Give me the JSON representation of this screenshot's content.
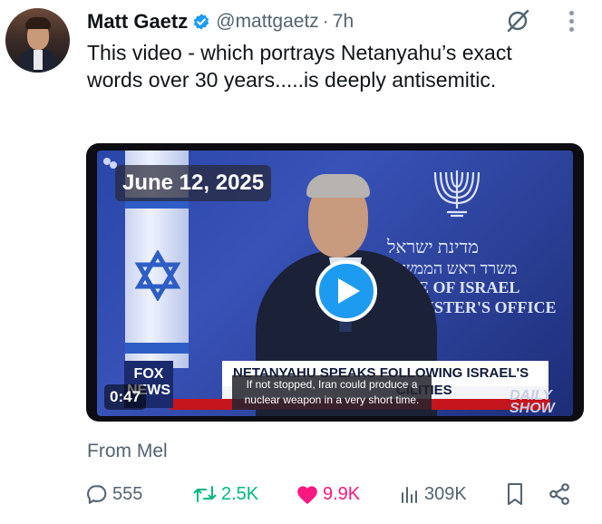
{
  "author": {
    "display_name": "Matt Gaetz",
    "handle": "@mattgaetz",
    "separator": "·",
    "time": "7h",
    "verified": true
  },
  "tweet": {
    "text": "This video - which portrays Netanyahu’s exact words over 30 years.....is deeply antisemitic."
  },
  "media": {
    "date_overlay": "June 12, 2025",
    "chyron_top": "NETANYAHU SPEAKS FOLLOWING ISRAEL'S",
    "chyron_bottom": "CILITIES",
    "subtitle": "If not stopped, Iran could produce a nuclear weapon in a very short time.",
    "timestamp": "0:47",
    "backdrop_hebrew_1": "מדינת ישראל",
    "backdrop_hebrew_2": "משרד ראש הממשלה",
    "backdrop_english_1": "E OF ISRAEL",
    "backdrop_english_2": "NISTER'S OFFICE",
    "network_logo": "FOX NEWS",
    "show_logo": "DAILY SHOW"
  },
  "source_label": "From Mel",
  "actions": {
    "replies": "555",
    "reposts": "2.5K",
    "likes": "9.9K",
    "views": "309K"
  },
  "colors": {
    "accent": "#1d9bf0",
    "repost": "#00ba7c",
    "like": "#f91880",
    "muted": "#536471"
  },
  "icons": [
    "verified-badge-icon",
    "grok-icon",
    "more-icon",
    "play-icon",
    "reply-icon",
    "repost-icon",
    "like-icon",
    "views-icon",
    "bookmark-icon",
    "share-icon"
  ]
}
